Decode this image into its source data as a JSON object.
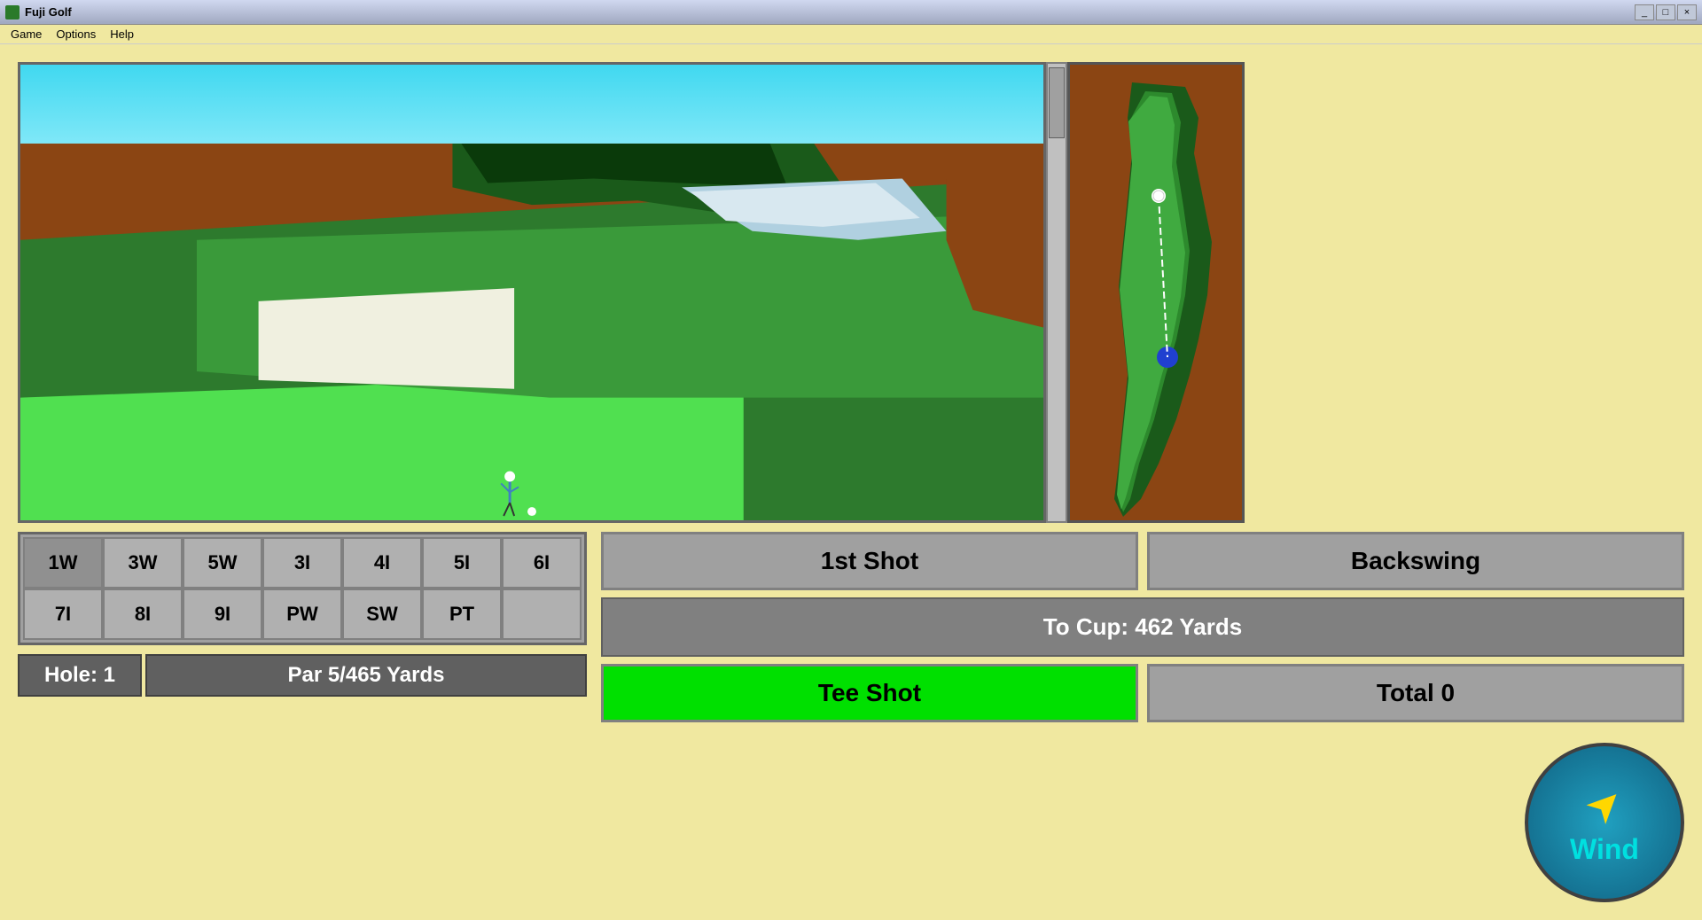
{
  "window": {
    "title": "Fuji Golf",
    "minimize": "_",
    "maximize": "□",
    "close": "×"
  },
  "menu": {
    "items": [
      "Game",
      "Options",
      "Help"
    ]
  },
  "clubs": {
    "row1": [
      "1W",
      "3W",
      "5W",
      "3I",
      "4I",
      "5I",
      "6I"
    ],
    "row2": [
      "7I",
      "8I",
      "9I",
      "PW",
      "SW",
      "PT",
      ""
    ]
  },
  "hole": {
    "label": "Hole: 1",
    "par": "Par 5/465 Yards"
  },
  "shot": {
    "first_shot": "1st Shot",
    "backswing": "Backswing",
    "to_cup": "To Cup: 462 Yards",
    "tee_shot": "Tee Shot",
    "total": "Total 0"
  },
  "wind": {
    "label": "Wind"
  }
}
